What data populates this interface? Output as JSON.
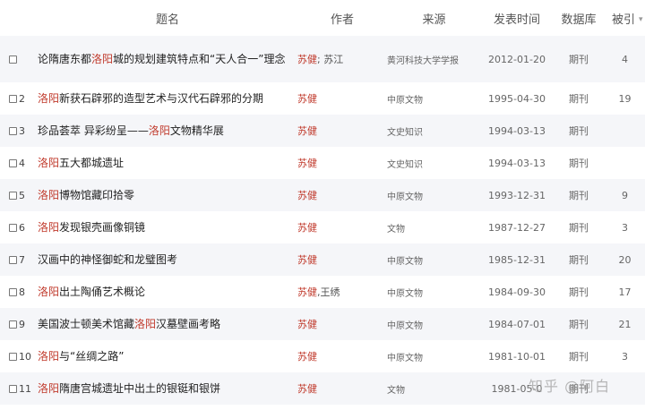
{
  "header": {
    "title": "题名",
    "author": "作者",
    "source": "来源",
    "date": "发表时间",
    "db": "数据库",
    "cite": "被引"
  },
  "rows": [
    {
      "idx": "",
      "title": [
        "论隋唐东都",
        "洛阳",
        "城的规划建筑特点和“天人合一”理念"
      ],
      "author_main": "苏健",
      "author_rest": "; 苏江",
      "source": "黄河科技大学学报",
      "date": "2012-01-20",
      "db": "期刊",
      "cite": "4"
    },
    {
      "idx": "2",
      "title": [
        "",
        "洛阳",
        "新获石辟邪的造型艺术与汉代石辟邪的分期"
      ],
      "author_main": "苏健",
      "author_rest": "",
      "source": "中原文物",
      "date": "1995-04-30",
      "db": "期刊",
      "cite": "19"
    },
    {
      "idx": "3",
      "title": [
        "珍品荟萃 异彩纷呈——",
        "洛阳",
        "文物精华展"
      ],
      "author_main": "苏健",
      "author_rest": "",
      "source": "文史知识",
      "date": "1994-03-13",
      "db": "期刊",
      "cite": ""
    },
    {
      "idx": "4",
      "title": [
        "",
        "洛阳",
        "五大都城遗址"
      ],
      "author_main": "苏健",
      "author_rest": "",
      "source": "文史知识",
      "date": "1994-03-13",
      "db": "期刊",
      "cite": ""
    },
    {
      "idx": "5",
      "title": [
        "",
        "洛阳",
        "博物馆藏印拾零"
      ],
      "author_main": "苏健",
      "author_rest": "",
      "source": "中原文物",
      "date": "1993-12-31",
      "db": "期刊",
      "cite": "9"
    },
    {
      "idx": "6",
      "title": [
        "",
        "洛阳",
        "发现银壳画像铜镜"
      ],
      "author_main": "苏健",
      "author_rest": "",
      "source": "文物",
      "date": "1987-12-27",
      "db": "期刊",
      "cite": "3"
    },
    {
      "idx": "7",
      "title": [
        "汉画中的神怪御蛇和龙璧图考",
        "",
        ""
      ],
      "author_main": "苏健",
      "author_rest": "",
      "source": "中原文物",
      "date": "1985-12-31",
      "db": "期刊",
      "cite": "20"
    },
    {
      "idx": "8",
      "title": [
        "",
        "洛阳",
        "出土陶俑艺术概论"
      ],
      "author_main": "苏健",
      "author_rest": ",王绣",
      "source": "中原文物",
      "date": "1984-09-30",
      "db": "期刊",
      "cite": "17"
    },
    {
      "idx": "9",
      "title": [
        "美国波士顿美术馆藏",
        "洛阳",
        "汉墓壁画考略"
      ],
      "author_main": "苏健",
      "author_rest": "",
      "source": "中原文物",
      "date": "1984-07-01",
      "db": "期刊",
      "cite": "21"
    },
    {
      "idx": "10",
      "title": [
        "",
        "洛阳",
        "与“丝绸之路”"
      ],
      "author_main": "苏健",
      "author_rest": "",
      "source": "中原文物",
      "date": "1981-10-01",
      "db": "期刊",
      "cite": "3"
    },
    {
      "idx": "11",
      "title": [
        "",
        "洛阳",
        "隋唐宫城遗址中出土的银铤和银饼"
      ],
      "author_main": "苏健",
      "author_rest": "",
      "source": "文物",
      "date": "1981-05-0",
      "db": "期刊",
      "cite": ""
    }
  ],
  "watermark": "知乎 @阿白"
}
